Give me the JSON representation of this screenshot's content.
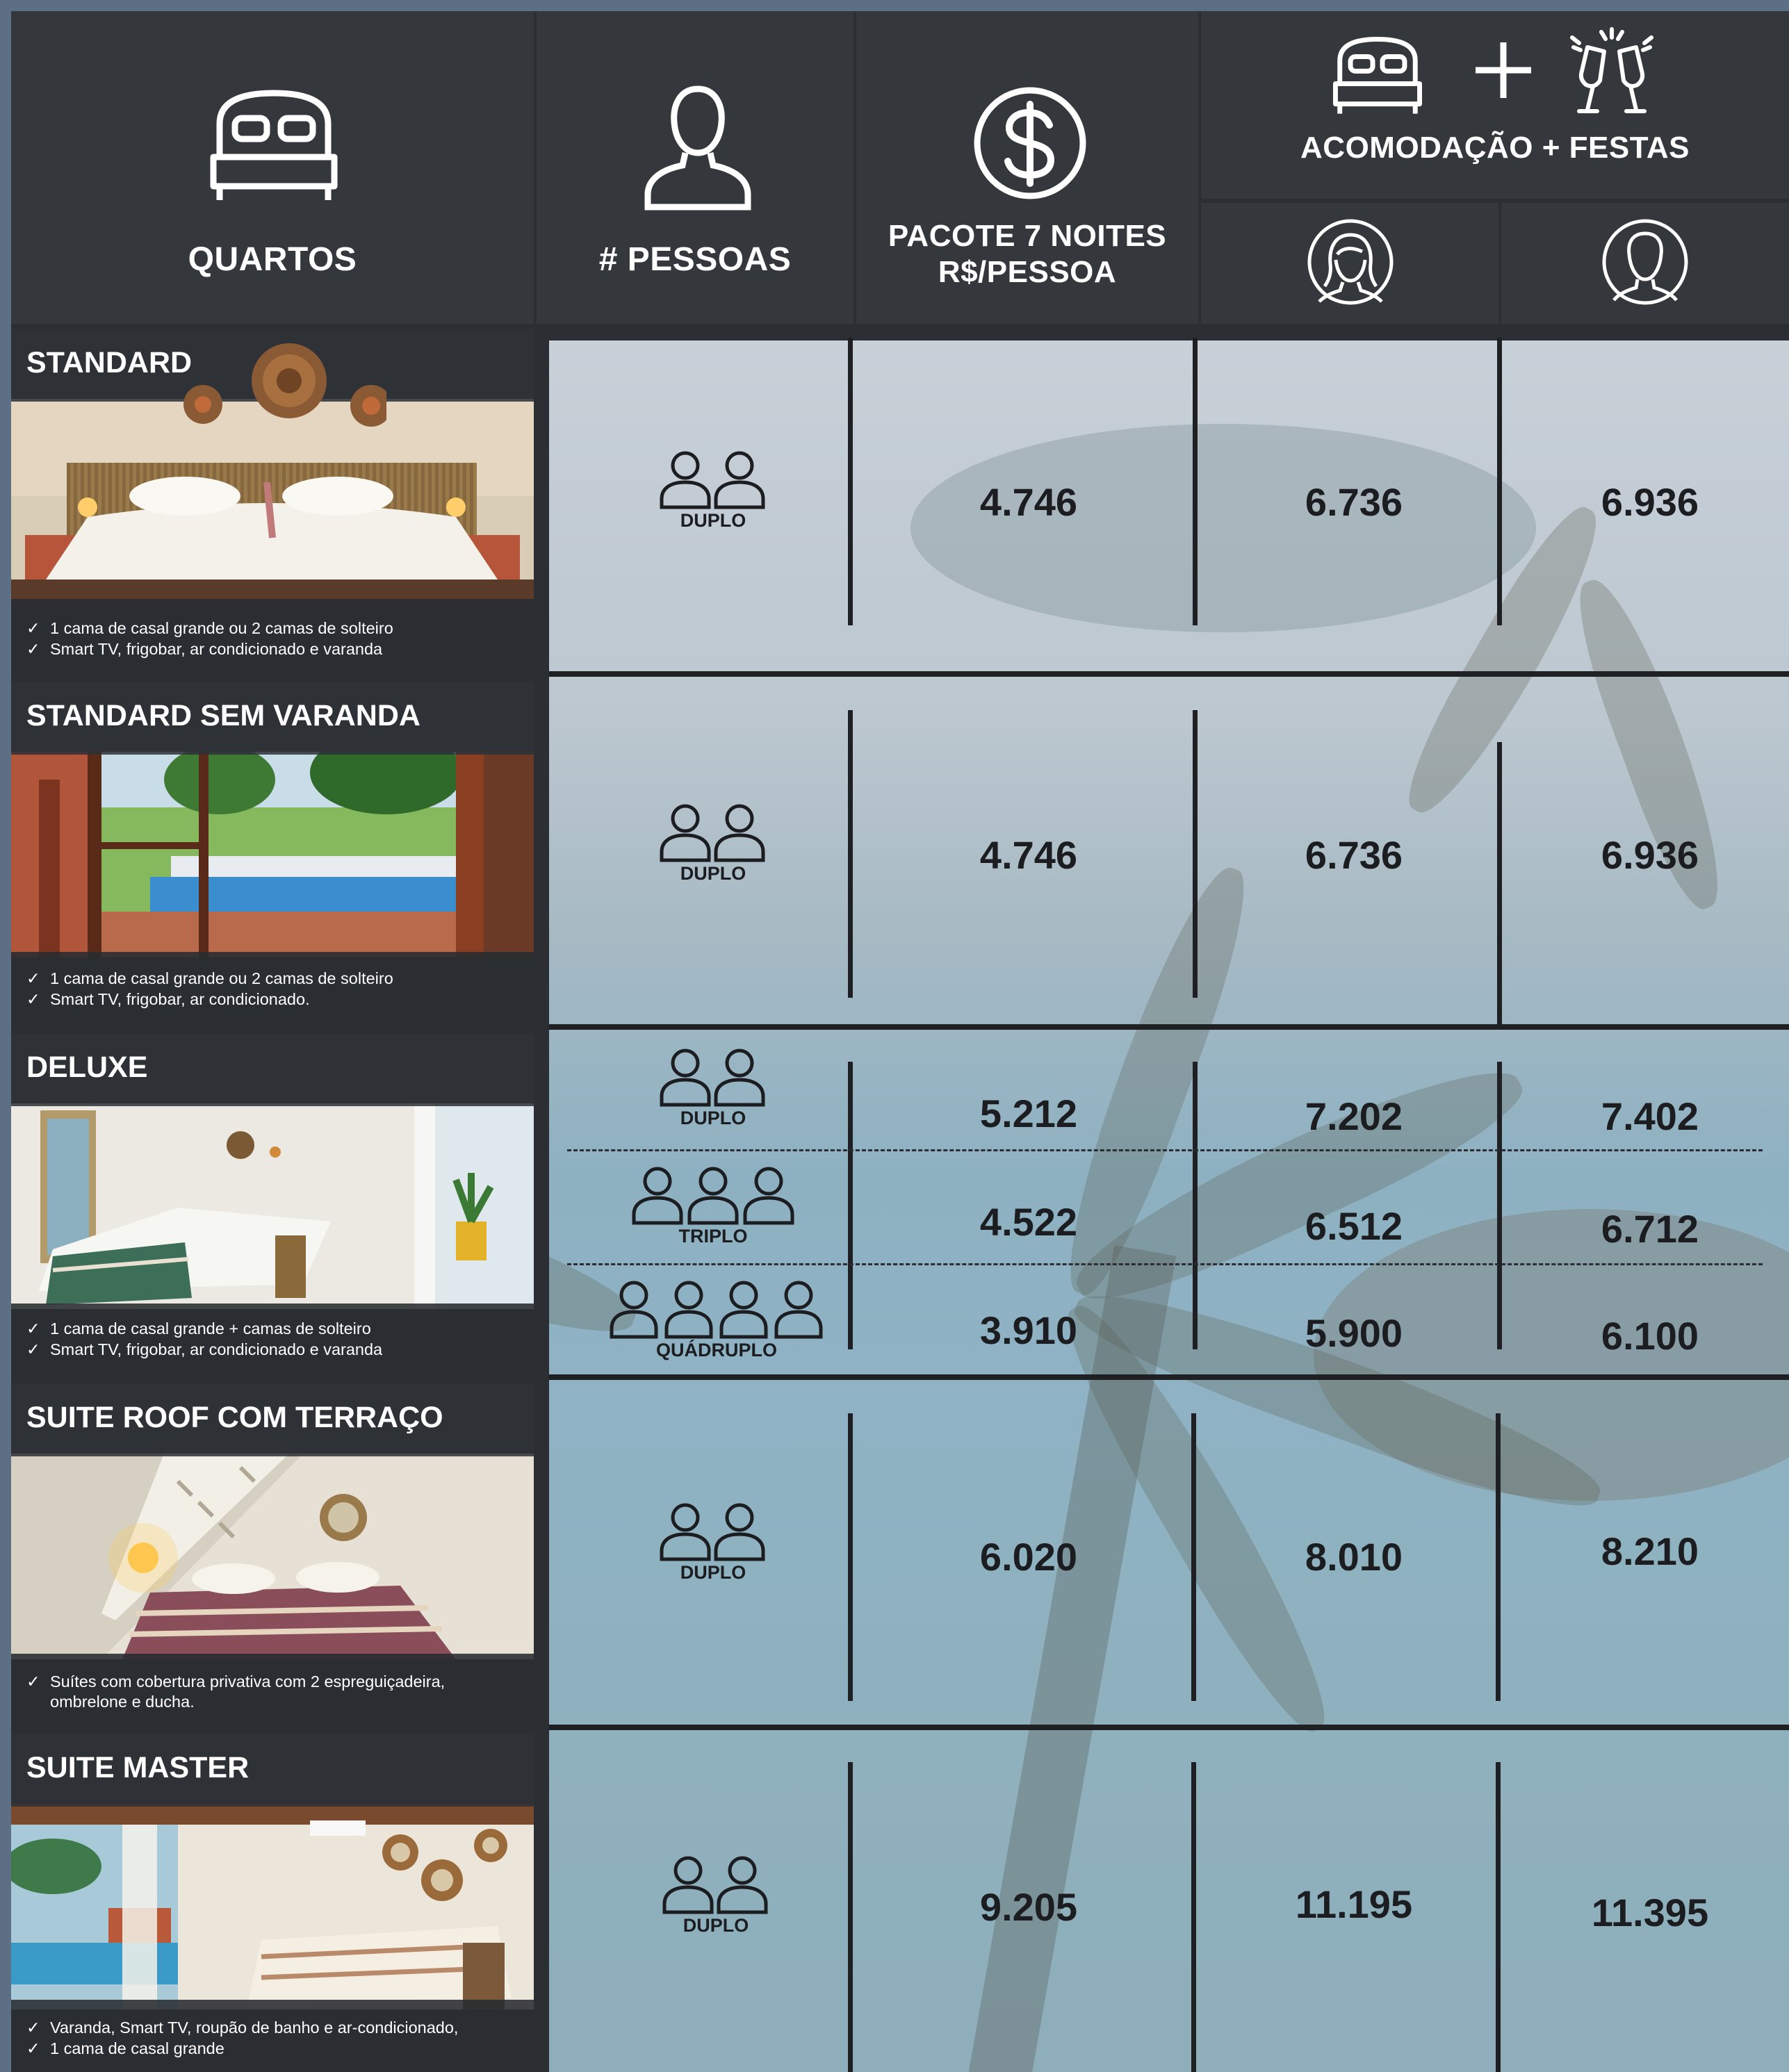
{
  "header": {
    "rooms_label": "QUARTOS",
    "people_label": "# PESSOAS",
    "package_label_line1": "PACOTE 7 NOITES",
    "package_label_line2": "R$/PESSOA",
    "combo_label": "ACOMODAÇÃO + FESTAS",
    "icons": [
      "bed-icon",
      "person-icon",
      "dollar-icon",
      "bed-icon",
      "plus-icon",
      "champagne-icon",
      "female-avatar-icon",
      "male-avatar-icon"
    ]
  },
  "rooms": [
    {
      "name": "STANDARD",
      "features": [
        "1 cama de casal grande ou 2 camas de solteiro",
        "Smart TV, frigobar, ar condicionado e varanda"
      ],
      "options": [
        {
          "occupancy": "DUPLO",
          "people": 2,
          "package": "4.746",
          "female": "6.736",
          "male": "6.936"
        }
      ]
    },
    {
      "name": "STANDARD SEM VARANDA",
      "features": [
        "1 cama de casal grande ou 2 camas de solteiro",
        "Smart TV, frigobar, ar condicionado."
      ],
      "options": [
        {
          "occupancy": "DUPLO",
          "people": 2,
          "package": "4.746",
          "female": "6.736",
          "male": "6.936"
        }
      ]
    },
    {
      "name": "DELUXE",
      "features": [
        "1 cama de casal grande + camas de solteiro",
        "Smart TV, frigobar, ar condicionado e varanda"
      ],
      "options": [
        {
          "occupancy": "DUPLO",
          "people": 2,
          "package": "5.212",
          "female": "7.202",
          "male": "7.402"
        },
        {
          "occupancy": "TRIPLO",
          "people": 3,
          "package": "4.522",
          "female": "6.512",
          "male": "6.712"
        },
        {
          "occupancy": "QUÁDRUPLO",
          "people": 4,
          "package": "3.910",
          "female": "5.900",
          "male": "6.100"
        }
      ]
    },
    {
      "name": "SUITE ROOF COM TERRAÇO",
      "features": [
        "Suítes  com cobertura privativa com 2 espreguiçadeira,",
        "ombrelone e ducha."
      ],
      "options": [
        {
          "occupancy": "DUPLO",
          "people": 2,
          "package": "6.020",
          "female": "8.010",
          "male": "8.210"
        }
      ]
    },
    {
      "name": "SUITE MASTER",
      "features": [
        "Varanda, Smart TV, roupão de banho e ar-condicionado,",
        "1 cama de casal grande"
      ],
      "options": [
        {
          "occupancy": "DUPLO",
          "people": 2,
          "package": "9.205",
          "female": "11.195",
          "male": "11.395"
        }
      ]
    }
  ]
}
